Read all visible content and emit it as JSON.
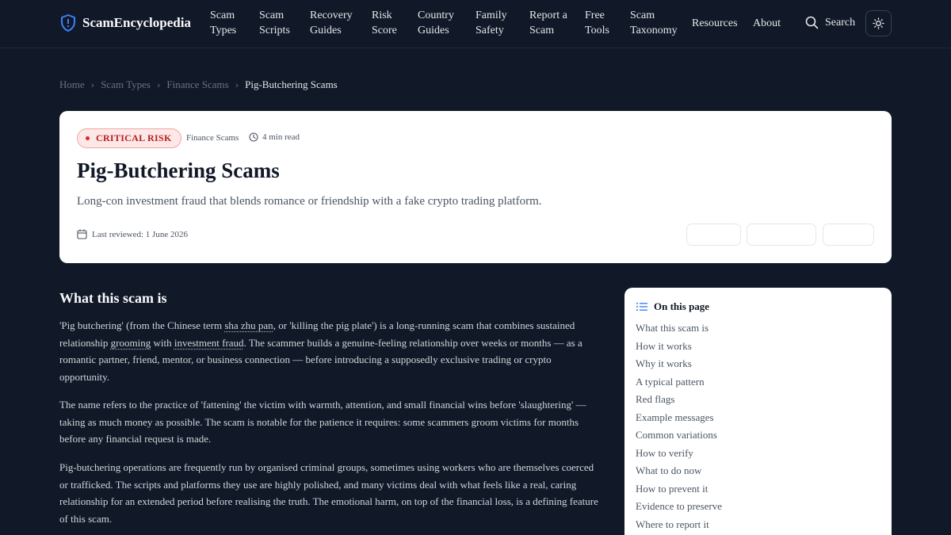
{
  "header": {
    "logo_text": "ScamEncyclopedia",
    "nav": [
      {
        "line1": "Scam",
        "line2": "Types"
      },
      {
        "line1": "Scam",
        "line2": "Scripts"
      },
      {
        "line1": "Recovery",
        "line2": "Guides"
      },
      {
        "line1": "Risk",
        "line2": "Score"
      },
      {
        "line1": "Country",
        "line2": "Guides"
      },
      {
        "line1": "Family",
        "line2": "Safety"
      },
      {
        "line1": "Report a",
        "line2": "Scam"
      },
      {
        "line1": "Free",
        "line2": "Tools"
      },
      {
        "line1": "Scam",
        "line2": "Taxonomy"
      },
      {
        "line1": "Resources",
        "line2": ""
      },
      {
        "line1": "About",
        "line2": ""
      }
    ],
    "search_label": "Search",
    "icons": {
      "logo": "shield-icon",
      "search": "search-icon",
      "theme": "sun-icon"
    }
  },
  "breadcrumb": [
    "Home",
    "Scam Types",
    "Finance Scams",
    "Pig-Butchering Scams"
  ],
  "hero": {
    "badge": "CRITICAL RISK",
    "category": "Finance Scams",
    "read_time": "4 min read",
    "title": "Pig-Butchering Scams",
    "subtitle": "Long-con investment fraud that blends romance or friendship with a fake crypto trading platform.",
    "reviewed": "Last reviewed: 1 June 2026"
  },
  "content": {
    "section_title": "What this scam is",
    "p1": {
      "a": "'Pig butchering' (from the Chinese term ",
      "term1": "sha zhu pan",
      "b": ", or 'killing the pig plate') is a long-running scam that combines sustained relationship ",
      "term2": "grooming",
      "c": " with ",
      "term3": "investment fraud",
      "d": ". The scammer builds a genuine-feeling relationship over weeks or months — as a romantic partner, friend, mentor, or business connection — before introducing a supposedly exclusive trading or crypto opportunity."
    },
    "p2": "The name refers to the practice of 'fattening' the victim with warmth, attention, and small financial wins before 'slaughtering' — taking as much money as possible. The scam is notable for the patience it requires: some scammers groom victims for months before any financial request is made.",
    "p3": "Pig-butchering operations are frequently run by organised criminal groups, sometimes using workers who are themselves coerced or trafficked. The scripts and platforms they use are highly polished, and many victims deal with what feels like a real, caring relationship for an extended period before realising the truth. The emotional harm, on top of the financial loss, is a defining feature of this scam."
  },
  "toc": {
    "title": "On this page",
    "items": [
      "What this scam is",
      "How it works",
      "Why it works",
      "A typical pattern",
      "Red flags",
      "Example messages",
      "Common variations",
      "How to verify",
      "What to do now",
      "How to prevent it",
      "Evidence to preserve",
      "Where to report it"
    ]
  },
  "colors": {
    "background": "#111827",
    "card": "#ffffff",
    "badge_red": "#b91c1c"
  }
}
